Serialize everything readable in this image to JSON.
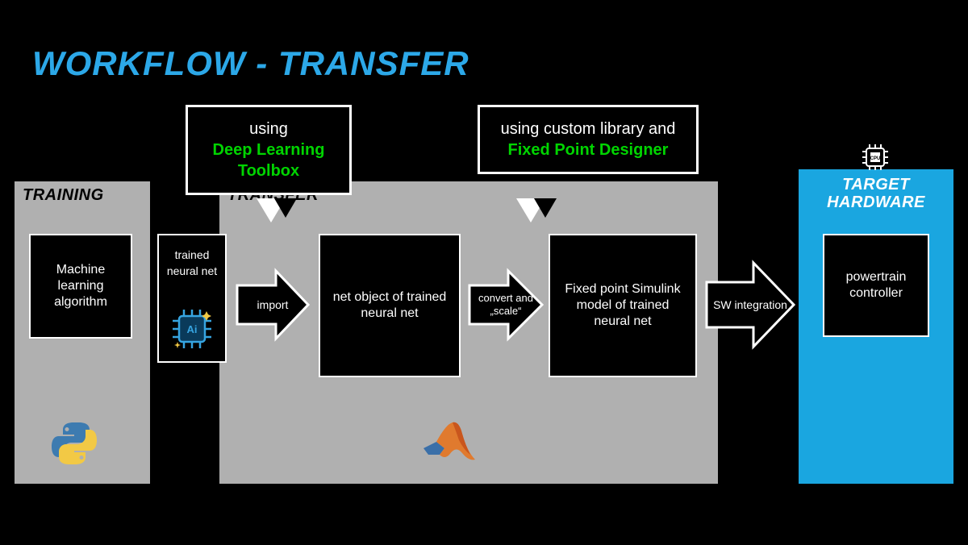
{
  "title": "WORKFLOW - TRANSFER",
  "sections": {
    "training": "TRAINING",
    "transfer": "TRANSFER",
    "target": "TARGET HARDWARE"
  },
  "boxes": {
    "ml_algo": "Machine learning algorithm",
    "trained_net": "trained neural net",
    "net_object": "net object of trained neural net",
    "fp_model": "Fixed point Simulink model of trained neural net",
    "controller": "powertrain controller"
  },
  "arrows": {
    "import": "import",
    "convert": "convert and „scale“",
    "sw": "SW integration"
  },
  "bubbles": {
    "b1_line1": "using",
    "b1_line2": "Deep Learning Toolbox",
    "b2_line1": "using custom library and",
    "b2_line2": "Fixed Point Designer"
  },
  "icons": {
    "python": "python-icon",
    "matlab": "matlab-icon",
    "cpu": "cpu-icon",
    "ai_chip": "ai-chip-icon"
  },
  "cpu_label": "CPU"
}
